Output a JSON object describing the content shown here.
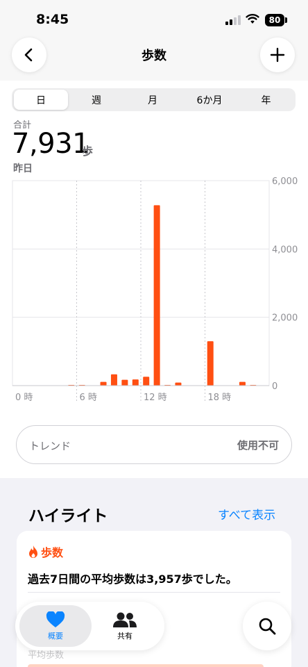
{
  "status_bar": {
    "time": "8:45",
    "battery": "80"
  },
  "nav": {
    "title": "歩数",
    "back_icon": "chevron-left-icon",
    "add_icon": "plus-icon"
  },
  "segments": [
    {
      "label": "日",
      "selected": true
    },
    {
      "label": "週",
      "selected": false
    },
    {
      "label": "月",
      "selected": false
    },
    {
      "label": "6か月",
      "selected": false
    },
    {
      "label": "年",
      "selected": false
    }
  ],
  "summary": {
    "label": "合計",
    "value": "7,931",
    "unit": "歩",
    "date": "昨日"
  },
  "chart_data": {
    "type": "bar",
    "x": [
      0,
      1,
      2,
      3,
      4,
      5,
      6,
      7,
      8,
      9,
      10,
      11,
      12,
      13,
      14,
      15,
      16,
      17,
      18,
      19,
      20,
      21,
      22,
      23
    ],
    "values": [
      0,
      0,
      0,
      0,
      0,
      20,
      15,
      0,
      110,
      330,
      170,
      180,
      260,
      5280,
      10,
      90,
      0,
      0,
      1300,
      0,
      0,
      110,
      10,
      0
    ],
    "x_tick_labels": [
      "0 時",
      "6 時",
      "12 時",
      "18 時"
    ],
    "y_tick_labels": [
      "6,000",
      "4,000",
      "2,000",
      "0"
    ],
    "ylim": [
      0,
      6000
    ],
    "bar_color": "#ff4f12",
    "grid": true
  },
  "trend": {
    "label": "トレンド",
    "value": "使用不可"
  },
  "highlights": {
    "title": "ハイライト",
    "show_all": "すべて表示",
    "card": {
      "category": "歩数",
      "category_icon": "flame-icon",
      "text": "過去7日間の平均歩数は3,957歩でした。",
      "sub_label": "平均歩数"
    }
  },
  "tabbar": {
    "items": [
      {
        "label": "概要",
        "icon": "heart-icon",
        "selected": true
      },
      {
        "label": "共有",
        "icon": "people-icon",
        "selected": false
      }
    ],
    "search_icon": "magnifier-icon"
  },
  "colors": {
    "accent": "#0a84ff",
    "steps": "#ff4f12"
  }
}
